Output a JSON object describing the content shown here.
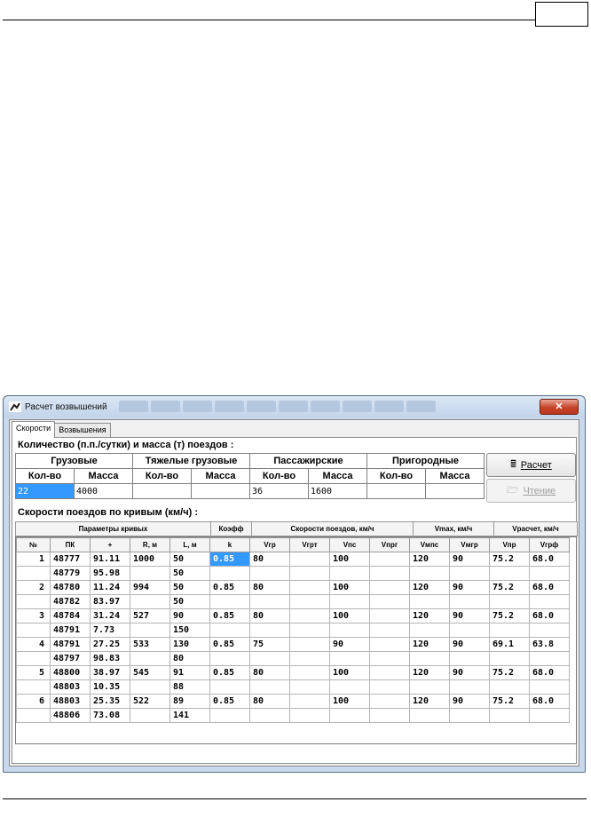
{
  "window": {
    "title": "Расчет возвышений",
    "close_label": "✕"
  },
  "tabs": [
    {
      "label": "Скорости",
      "active": true
    },
    {
      "label": "Возвышения",
      "active": false
    }
  ],
  "traffic": {
    "section_title": "Количество (п.п./сутки) и масса (т) поездов :",
    "groups": [
      "Грузовые",
      "Тяжелые грузовые",
      "Пассажирские",
      "Пригородные"
    ],
    "subheaders": [
      "Кол-во",
      "Масса",
      "Кол-во",
      "Масса",
      "Кол-во",
      "Масса",
      "Кол-во",
      "Масса"
    ],
    "values": [
      "22",
      "4000",
      "",
      "",
      "36",
      "1600",
      "",
      ""
    ]
  },
  "buttons": {
    "calc_label": "Расчет",
    "read_label": "Чтение"
  },
  "curves": {
    "section_title": "Скорости поездов по кривым (км/ч) :",
    "group_headers": [
      "Параметры кривых",
      "Коэфф",
      "Скорости поездов, км/ч",
      "Vmax, км/ч",
      "Vрасчет, км/ч"
    ],
    "columns": [
      "№",
      "ПК",
      "+",
      "R, м",
      "L, м",
      "k",
      "Vгр",
      "Vгрт",
      "Vпс",
      "Vпрг",
      "Vмпс",
      "Vмгр",
      "Vпр",
      "Vгрф"
    ],
    "rows": [
      [
        "1",
        "48777",
        "91.11",
        "1000",
        "50",
        "0.85",
        "80",
        "",
        "100",
        "",
        "120",
        "90",
        "75.2",
        "68.0"
      ],
      [
        "",
        "48779",
        "95.98",
        "",
        "50",
        "",
        "",
        "",
        "",
        "",
        "",
        "",
        "",
        ""
      ],
      [
        "2",
        "48780",
        "11.24",
        "994",
        "50",
        "0.85",
        "80",
        "",
        "100",
        "",
        "120",
        "90",
        "75.2",
        "68.0"
      ],
      [
        "",
        "48782",
        "83.97",
        "",
        "50",
        "",
        "",
        "",
        "",
        "",
        "",
        "",
        "",
        ""
      ],
      [
        "3",
        "48784",
        "31.24",
        "527",
        "90",
        "0.85",
        "80",
        "",
        "100",
        "",
        "120",
        "90",
        "75.2",
        "68.0"
      ],
      [
        "",
        "48791",
        "7.73",
        "",
        "150",
        "",
        "",
        "",
        "",
        "",
        "",
        "",
        "",
        ""
      ],
      [
        "4",
        "48791",
        "27.25",
        "533",
        "130",
        "0.85",
        "75",
        "",
        "90",
        "",
        "120",
        "90",
        "69.1",
        "63.8"
      ],
      [
        "",
        "48797",
        "98.83",
        "",
        "80",
        "",
        "",
        "",
        "",
        "",
        "",
        "",
        "",
        ""
      ],
      [
        "5",
        "48800",
        "38.97",
        "545",
        "91",
        "0.85",
        "80",
        "",
        "100",
        "",
        "120",
        "90",
        "75.2",
        "68.0"
      ],
      [
        "",
        "48803",
        "10.35",
        "",
        "88",
        "",
        "",
        "",
        "",
        "",
        "",
        "",
        "",
        ""
      ],
      [
        "6",
        "48803",
        "25.35",
        "522",
        "89",
        "0.85",
        "80",
        "",
        "100",
        "",
        "120",
        "90",
        "75.2",
        "68.0"
      ],
      [
        "",
        "48806",
        "73.08",
        "",
        "141",
        "",
        "",
        "",
        "",
        "",
        "",
        "",
        "",
        ""
      ]
    ]
  }
}
